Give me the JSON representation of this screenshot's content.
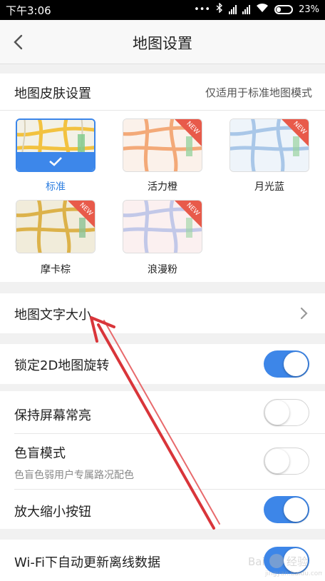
{
  "status_bar": {
    "time": "下午3:06",
    "battery": "23%",
    "icons": [
      "bluetooth-icon",
      "signal-icon",
      "signal-icon",
      "wifi-icon",
      "battery-icon"
    ]
  },
  "header": {
    "title": "地图设置",
    "back_icon": "chevron-left-icon"
  },
  "skin": {
    "title": "地图皮肤设置",
    "note": "仅适用于标准地图模式",
    "themes": [
      {
        "label": "标准",
        "selected": true,
        "is_new": false,
        "color": "#f1b73a"
      },
      {
        "label": "活力橙",
        "selected": false,
        "is_new": true,
        "color": "#f0a06a"
      },
      {
        "label": "月光蓝",
        "selected": false,
        "is_new": true,
        "color": "#9fc2e6"
      },
      {
        "label": "摩卡棕",
        "selected": false,
        "is_new": true,
        "color": "#d8b050"
      },
      {
        "label": "浪漫粉",
        "selected": false,
        "is_new": true,
        "color": "#c2c8e8"
      }
    ],
    "new_badge": "NEW"
  },
  "settings": {
    "text_size": "地图文字大小",
    "lock_2d": {
      "label": "锁定2D地图旋转",
      "on": true
    },
    "keep_screen_on": {
      "label": "保持屏幕常亮",
      "on": false
    },
    "color_blind": {
      "label": "色盲模式",
      "sub": "色盲色弱用户专属路况配色",
      "on": false
    },
    "zoom_buttons": {
      "label": "放大缩小按钮",
      "on": true
    },
    "wifi_update": {
      "label": "Wi-Fi下自动更新离线数据",
      "on": true
    }
  },
  "colors": {
    "accent": "#3d86e8",
    "arrow": "#d9353a"
  }
}
